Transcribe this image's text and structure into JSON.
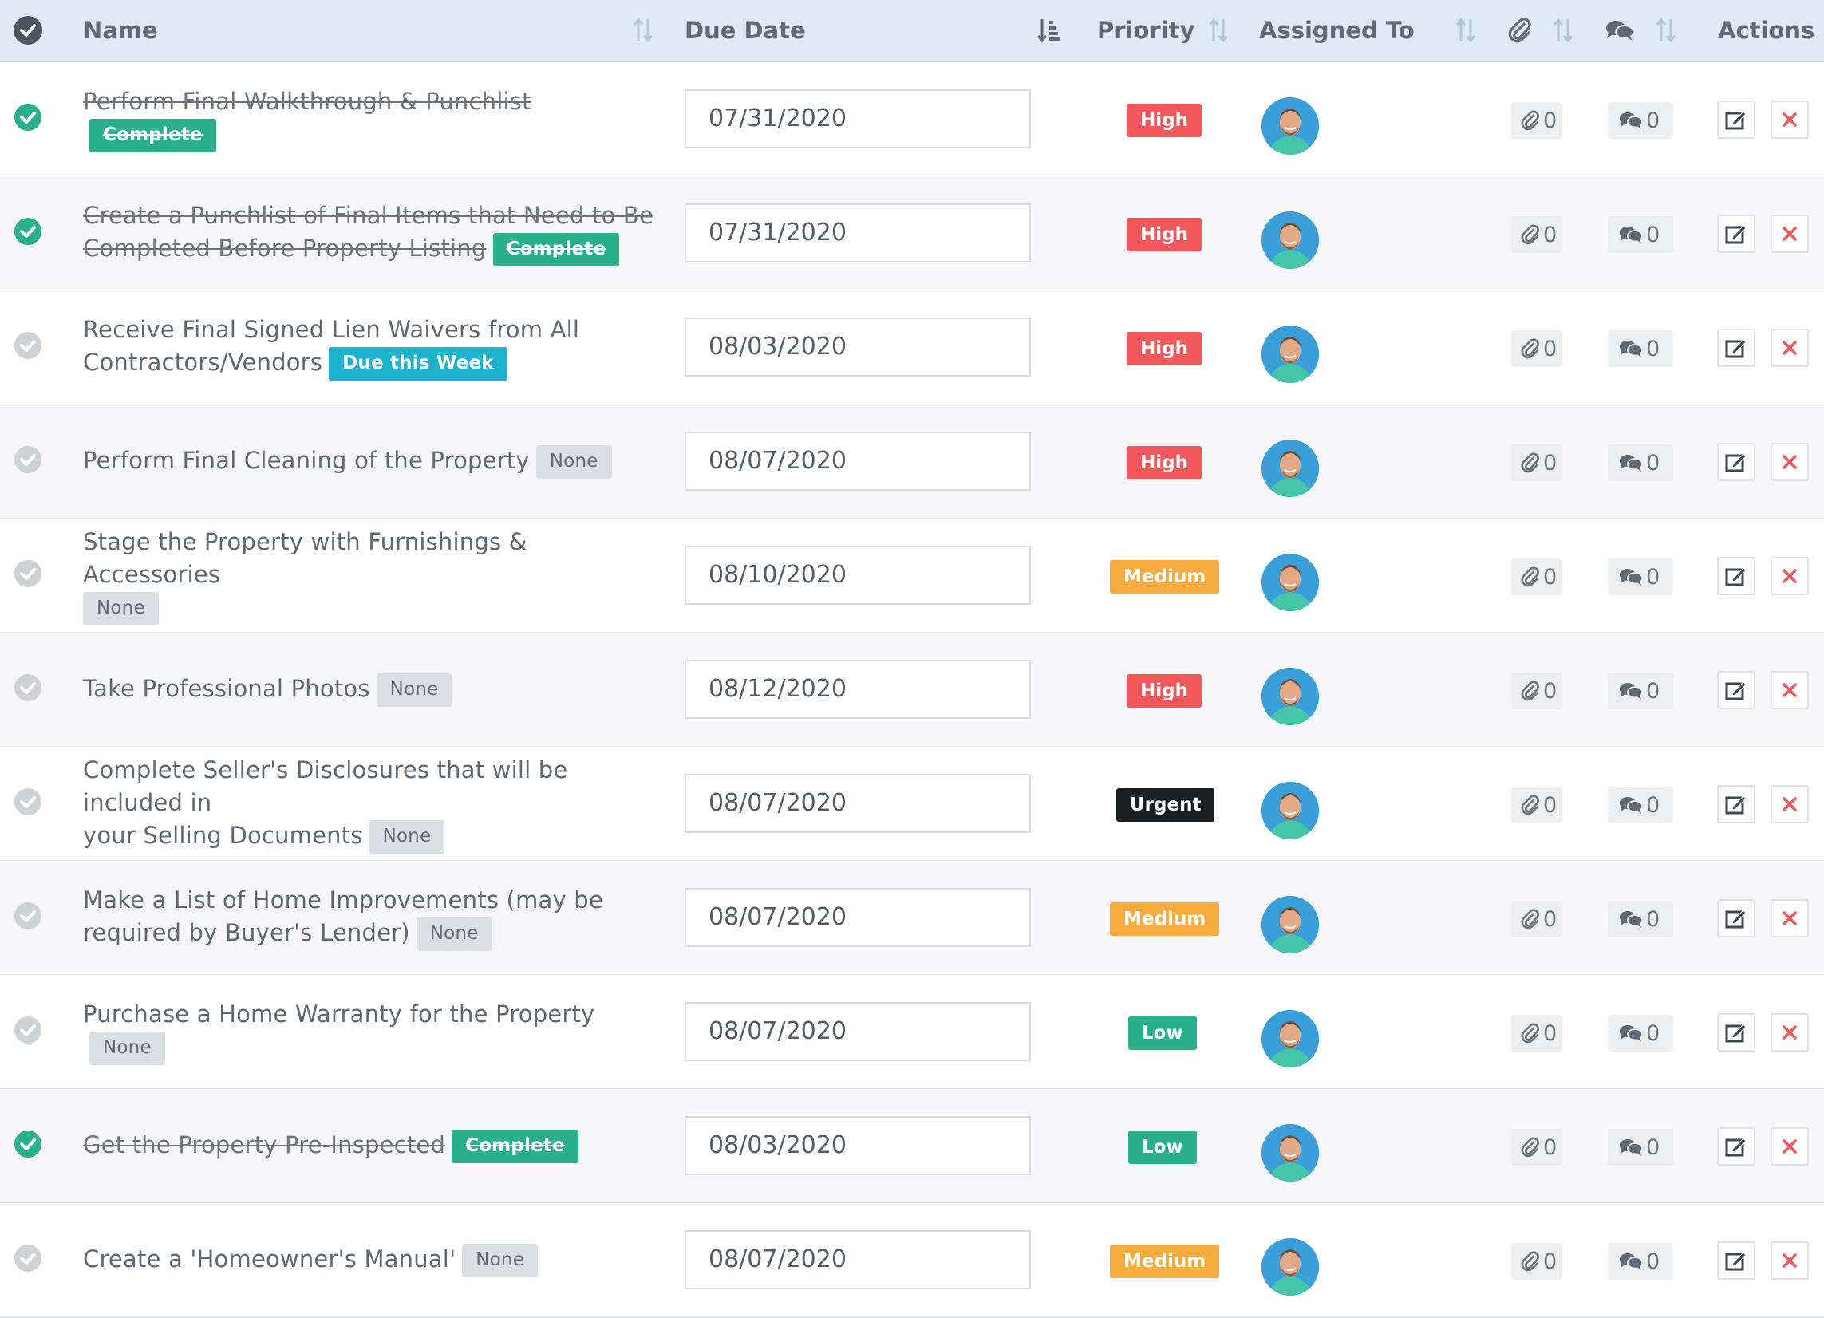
{
  "header": {
    "name": "Name",
    "due_date": "Due Date",
    "priority": "Priority",
    "assigned_to": "Assigned To",
    "actions": "Actions"
  },
  "colors": {
    "complete": "#2bb08c",
    "high": "#f2575b",
    "medium": "#f8ab3d",
    "urgent": "#1b1e22",
    "low": "#2bb08c",
    "due_week": "#1fb2cf",
    "header_bg": "#dfeaf6"
  },
  "tasks": [
    {
      "done": true,
      "name_lines": [
        "Perform Final Walkthrough & Punchlist"
      ],
      "status": "Complete",
      "status_type": "complete",
      "due": "07/31/2020",
      "priority": "High",
      "priority_type": "high",
      "attachments": "0",
      "comments": "0"
    },
    {
      "done": true,
      "name_lines": [
        "Create a Punchlist of Final Items that Need to Be",
        "Completed Before Property Listing"
      ],
      "status": "Complete",
      "status_type": "complete",
      "due": "07/31/2020",
      "priority": "High",
      "priority_type": "high",
      "attachments": "0",
      "comments": "0"
    },
    {
      "done": false,
      "name_lines": [
        "Receive Final Signed Lien Waivers from All",
        "Contractors/Vendors"
      ],
      "status": "Due this Week",
      "status_type": "week",
      "due": "08/03/2020",
      "priority": "High",
      "priority_type": "high",
      "attachments": "0",
      "comments": "0"
    },
    {
      "done": false,
      "name_lines": [
        "Perform Final Cleaning of the Property"
      ],
      "status": "None",
      "status_type": "none",
      "due": "08/07/2020",
      "priority": "High",
      "priority_type": "high",
      "attachments": "0",
      "comments": "0"
    },
    {
      "done": false,
      "name_lines": [
        "Stage the Property with Furnishings & Accessories",
        ""
      ],
      "status": "None",
      "status_type": "none",
      "due": "08/10/2020",
      "priority": "Medium",
      "priority_type": "medium",
      "attachments": "0",
      "comments": "0"
    },
    {
      "done": false,
      "name_lines": [
        "Take Professional Photos"
      ],
      "status": "None",
      "status_type": "none",
      "due": "08/12/2020",
      "priority": "High",
      "priority_type": "high",
      "attachments": "0",
      "comments": "0"
    },
    {
      "done": false,
      "name_lines": [
        "Complete Seller's Disclosures that will be included in",
        "your Selling Documents"
      ],
      "status": "None",
      "status_type": "none",
      "due": "08/07/2020",
      "priority": "Urgent",
      "priority_type": "urgent",
      "attachments": "0",
      "comments": "0"
    },
    {
      "done": false,
      "name_lines": [
        "Make a List of Home Improvements (may be",
        "required by Buyer's Lender)"
      ],
      "status": "None",
      "status_type": "none",
      "due": "08/07/2020",
      "priority": "Medium",
      "priority_type": "medium",
      "attachments": "0",
      "comments": "0"
    },
    {
      "done": false,
      "name_lines": [
        "Purchase a Home Warranty for the Property"
      ],
      "status": "None",
      "status_type": "none",
      "due": "08/07/2020",
      "priority": "Low",
      "priority_type": "low",
      "attachments": "0",
      "comments": "0"
    },
    {
      "done": true,
      "name_lines": [
        "Get the Property Pre-Inspected"
      ],
      "status": "Complete",
      "status_type": "complete",
      "due": "08/03/2020",
      "priority": "Low",
      "priority_type": "low",
      "attachments": "0",
      "comments": "0"
    },
    {
      "done": false,
      "name_lines": [
        "Create a 'Homeowner's Manual'"
      ],
      "status": "None",
      "status_type": "none",
      "due": "08/07/2020",
      "priority": "Medium",
      "priority_type": "medium",
      "attachments": "0",
      "comments": "0"
    }
  ]
}
